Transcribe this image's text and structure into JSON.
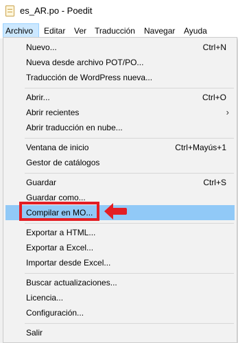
{
  "window": {
    "title": "es_AR.po - Poedit",
    "app_icon": "poedit-document-icon"
  },
  "menubar": {
    "items": [
      {
        "label": "Archivo"
      },
      {
        "label": "Editar"
      },
      {
        "label": "Ver"
      },
      {
        "label": "Traducción"
      },
      {
        "label": "Navegar"
      },
      {
        "label": "Ayuda"
      }
    ],
    "active": "Archivo"
  },
  "file_menu": {
    "items": [
      {
        "label": "Nuevo...",
        "shortcut": "Ctrl+N"
      },
      {
        "label": "Nueva desde archivo POT/PO..."
      },
      {
        "label": "Traducción de WordPress nueva..."
      },
      {
        "label": "Abrir...",
        "shortcut": "Ctrl+O"
      },
      {
        "label": "Abrir recientes",
        "submenu": true,
        "submenu_glyph": "›"
      },
      {
        "label": "Abrir traducción en nube..."
      },
      {
        "label": "Ventana de inicio",
        "shortcut": "Ctrl+Mayús+1"
      },
      {
        "label": "Gestor de catálogos"
      },
      {
        "label": "Guardar",
        "shortcut": "Ctrl+S"
      },
      {
        "label": "Guardar como..."
      },
      {
        "label": "Compilar en MO...",
        "highlighted": true
      },
      {
        "label": "Exportar a HTML..."
      },
      {
        "label": "Exportar a Excel..."
      },
      {
        "label": "Importar desde Excel..."
      },
      {
        "label": "Buscar actualizaciones..."
      },
      {
        "label": "Licencia..."
      },
      {
        "label": "Configuración..."
      },
      {
        "label": "Salir"
      }
    ]
  },
  "annotation": {
    "color": "#e31e24",
    "arrow_icon": "left-arrow-icon"
  },
  "colors": {
    "menu_highlight": "#91c9f7",
    "menubar_active": "#cce8ff",
    "menu_background": "#f2f2f2"
  }
}
